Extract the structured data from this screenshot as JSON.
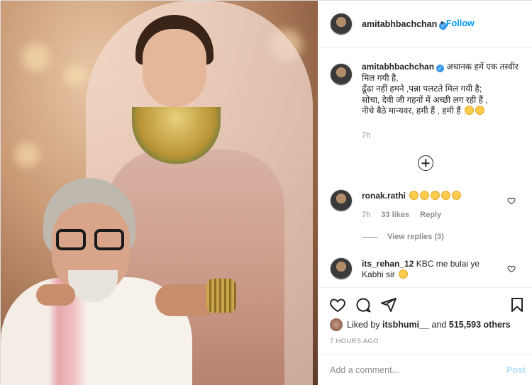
{
  "post": {
    "author": "amitabhbachchan",
    "follow_label": "Follow",
    "header_dot": "•",
    "caption": {
      "line1": "अचानक हमें एक तस्वीर मिल गयी है,",
      "line2": "ढूँढा नहीं हमने ,पन्ना पलटते मिल गयी है;",
      "line3": "सोचा, देवी जी गहनों में अच्छी लग रही हैं ,",
      "line4": "नीचे बैठे मान्यवर, हमी हैं , हमी हैं"
    },
    "caption_time": "7h"
  },
  "comments": [
    {
      "username": "ronak.rathi",
      "time": "7h",
      "likes": "33 likes",
      "reply_label": "Reply",
      "view_replies": "View replies (3)"
    },
    {
      "username": "its_rehan_12",
      "text": "KBC me bulai ye Kabhi sir"
    }
  ],
  "likes": {
    "prefix": "Liked by",
    "user": "itsbhumi__",
    "middle": "and",
    "count": "515,593 others"
  },
  "timestamp": "7 HOURS AGO",
  "add_comment": {
    "placeholder": "Add a comment...",
    "post_label": "Post"
  },
  "icons": {
    "like": "heart-icon",
    "comment": "comment-icon",
    "share": "paper-plane-icon",
    "save": "bookmark-icon",
    "load_more": "plus-circle-icon",
    "verified": "verified-badge-icon"
  },
  "colors": {
    "accent": "#0095f6",
    "verified": "#3897f0",
    "secondary_text": "#8e8e8e",
    "post_disabled": "#b2dffc"
  }
}
